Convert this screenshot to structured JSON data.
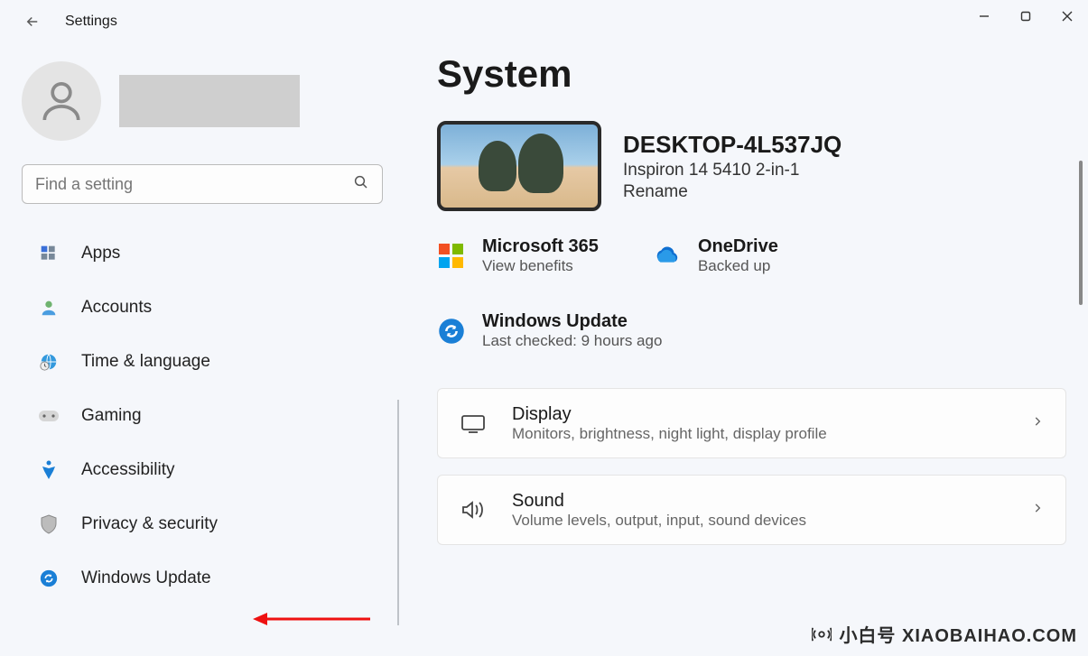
{
  "app_title": "Settings",
  "search": {
    "placeholder": "Find a setting"
  },
  "sidebar": {
    "items": [
      {
        "label": "Apps"
      },
      {
        "label": "Accounts"
      },
      {
        "label": "Time & language"
      },
      {
        "label": "Gaming"
      },
      {
        "label": "Accessibility"
      },
      {
        "label": "Privacy & security"
      },
      {
        "label": "Windows Update"
      }
    ]
  },
  "page": {
    "title": "System"
  },
  "device": {
    "name": "DESKTOP-4L537JQ",
    "model": "Inspiron 14 5410 2-in-1",
    "rename": "Rename"
  },
  "tiles": {
    "m365": {
      "title": "Microsoft 365",
      "sub": "View benefits"
    },
    "onedrive": {
      "title": "OneDrive",
      "sub": "Backed up"
    },
    "update": {
      "title": "Windows Update",
      "sub": "Last checked: 9 hours ago"
    }
  },
  "cards": {
    "display": {
      "title": "Display",
      "sub": "Monitors, brightness, night light, display profile"
    },
    "sound": {
      "title": "Sound",
      "sub": "Volume levels, output, input, sound devices"
    }
  },
  "watermark": "小白号 XIAOBAIHAO.COM"
}
